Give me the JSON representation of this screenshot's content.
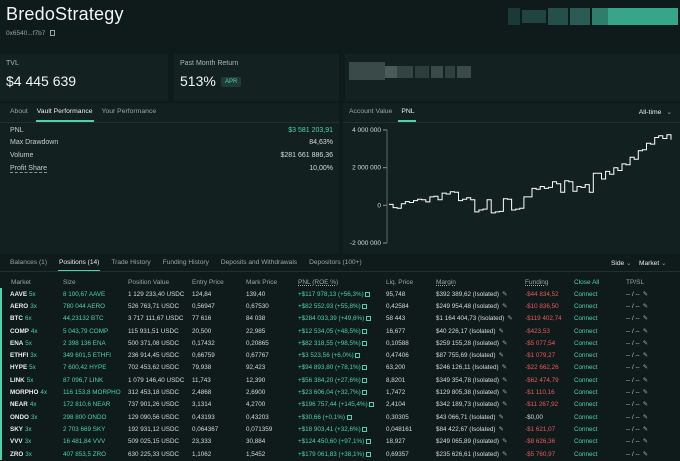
{
  "header": {
    "title": "BredoStrategy",
    "address": "0x6540...f7b7"
  },
  "tvl": {
    "label": "TVL",
    "value": "$4 445 639"
  },
  "pmr": {
    "label": "Past Month Return",
    "value": "513%",
    "badge": "APR"
  },
  "left_tabs": [
    "About",
    "Vault Performance",
    "Your Performance"
  ],
  "stats": [
    {
      "k": "PNL",
      "v": "$3 581 203,91",
      "color": "green"
    },
    {
      "k": "Max Drawdown",
      "v": "84,63%",
      "color": "plain"
    },
    {
      "k": "Volume",
      "v": "$281 661 886,36",
      "color": "plain"
    },
    {
      "k": "Profit Share",
      "v": "10,00%",
      "color": "plain"
    }
  ],
  "chart_tabs": [
    "Account Value",
    "PNL"
  ],
  "chart_range": "All-time",
  "chart_data": {
    "type": "line",
    "title": "",
    "ylabel": "",
    "yticks": [
      "4 000 000",
      "2 000 000",
      "0",
      "-2 000 000"
    ],
    "ylim": [
      -2000000,
      4000000
    ],
    "x": [
      0,
      1,
      2,
      3,
      4,
      5,
      6,
      7,
      8,
      9,
      10,
      11,
      12,
      13,
      14,
      15,
      16,
      17,
      18,
      19,
      20,
      21,
      22,
      23,
      24,
      25,
      26,
      27,
      28,
      29,
      30,
      31,
      32,
      33,
      34,
      35,
      36,
      37,
      38,
      39,
      40,
      41,
      42,
      43,
      44,
      45,
      46,
      47,
      48,
      49,
      50,
      51,
      52,
      53,
      54,
      55,
      56,
      57,
      58,
      59,
      60,
      61,
      62,
      63,
      64,
      65,
      66,
      67,
      68,
      69
    ],
    "values": [
      50000,
      -120000,
      -150000,
      80000,
      200000,
      150000,
      250000,
      320000,
      300000,
      180000,
      450000,
      480000,
      300000,
      650000,
      600000,
      720000,
      700000,
      250000,
      320000,
      400000,
      300000,
      -350000,
      -250000,
      -200000,
      300000,
      -400000,
      -350000,
      -320000,
      350000,
      320000,
      -250000,
      -200000,
      -150000,
      450000,
      450000,
      900000,
      850000,
      1000000,
      900000,
      950000,
      1250000,
      1150000,
      700000,
      1300000,
      1250000,
      750000,
      1000000,
      950000,
      1100000,
      700000,
      1700000,
      1700000,
      1400000,
      1800000,
      1650000,
      2000000,
      1850000,
      2200000,
      2150000,
      2550000,
      2450000,
      2900000,
      2950000,
      3300000,
      3250000,
      3600000,
      3700000,
      3550000,
      3750000,
      3480000
    ],
    "line_color": "#ffffff"
  },
  "bottom_tabs": [
    "Balances (1)",
    "Positions (14)",
    "Trade History",
    "Funding History",
    "Deposits and Withdrawals",
    "Depositors (100+)"
  ],
  "filters": [
    "Side",
    "Market"
  ],
  "columns": [
    "Market",
    "Size",
    "Position Value",
    "Entry Price",
    "Mark Price",
    "PNL (ROE %)",
    "Liq. Price",
    "Margin",
    "Funding",
    "Close All",
    "TP/SL"
  ],
  "positions": [
    {
      "coin": "AAVE",
      "lev": "5x",
      "size": "8 100,67 AAVE",
      "value": "1 129 233,40 USDC",
      "entry": "124,84",
      "mark": "139,40",
      "pnl": "+$117 978,13 (+56,3%)",
      "pnl_pos": true,
      "liq": "95,748",
      "margin": "$392 389,62 (Isolated)",
      "funding": "-$44 834,52",
      "fund_pos": false
    },
    {
      "coin": "AERO",
      "lev": "3x",
      "size": "780 044 AERO",
      "value": "526 763,71 USDC",
      "entry": "0,56947",
      "mark": "0,67530",
      "pnl": "+$82 552,93 (+55,8%)",
      "pnl_pos": true,
      "liq": "0,42584",
      "margin": "$249 954,48 (Isolated)",
      "funding": "-$10 836,50",
      "fund_pos": false
    },
    {
      "coin": "BTC",
      "lev": "6x",
      "size": "44,23132 BTC",
      "value": "3 717 111,67 USDC",
      "entry": "77 616",
      "mark": "84 038",
      "pnl": "+$284 033,39 (+49,6%)",
      "pnl_pos": true,
      "liq": "58 443",
      "margin": "$1 164 404,73 (Isolated)",
      "funding": "-$119 402,74",
      "fund_pos": false
    },
    {
      "coin": "COMP",
      "lev": "4x",
      "size": "5 043,79 COMP",
      "value": "115 931,51 USDC",
      "entry": "20,500",
      "mark": "22,985",
      "pnl": "+$12 534,05 (+48,5%)",
      "pnl_pos": true,
      "liq": "16,677",
      "margin": "$40 226,17 (Isolated)",
      "funding": "-$423,53",
      "fund_pos": false
    },
    {
      "coin": "ENA",
      "lev": "5x",
      "size": "2 398 136 ENA",
      "value": "500 371,08 USDC",
      "entry": "0,17432",
      "mark": "0,20865",
      "pnl": "+$82 318,55 (+98,5%)",
      "pnl_pos": true,
      "liq": "0,10588",
      "margin": "$259 155,28 (Isolated)",
      "funding": "-$5 077,54",
      "fund_pos": false
    },
    {
      "coin": "ETHFI",
      "lev": "3x",
      "size": "349 601,5 ETHFI",
      "value": "236 914,45 USDC",
      "entry": "0,66759",
      "mark": "0,67767",
      "pnl": "+$3 523,56 (+6,0%)",
      "pnl_pos": true,
      "liq": "0,47406",
      "margin": "$87 755,69 (Isolated)",
      "funding": "-$1 079,27",
      "fund_pos": false
    },
    {
      "coin": "HYPE",
      "lev": "5x",
      "size": "7 600,42 HYPE",
      "value": "702 453,62 USDC",
      "entry": "79,938",
      "mark": "92,423",
      "pnl": "+$94 893,80 (+78,1%)",
      "pnl_pos": true,
      "liq": "63,200",
      "margin": "$246 126,11 (Isolated)",
      "funding": "-$22 662,26",
      "fund_pos": false
    },
    {
      "coin": "LINK",
      "lev": "5x",
      "size": "87 096,7 LINK",
      "value": "1 079 146,40 USDC",
      "entry": "11,743",
      "mark": "12,390",
      "pnl": "+$56 384,20 (+27,6%)",
      "pnl_pos": true,
      "liq": "8,8201",
      "margin": "$349 354,78 (Isolated)",
      "funding": "-$62 474,79",
      "fund_pos": false
    },
    {
      "coin": "MORPHO",
      "lev": "4x",
      "size": "116 153,8 MORPHO",
      "value": "312 453,18 USDC",
      "entry": "2,4868",
      "mark": "2,6900",
      "pnl": "+$23 606,04 (+32,7%)",
      "pnl_pos": true,
      "liq": "1,7472",
      "margin": "$129 805,38 (Isolated)",
      "funding": "-$1 110,16",
      "fund_pos": false
    },
    {
      "coin": "NEAR",
      "lev": "4x",
      "size": "172 810,6 NEAR",
      "value": "737 901,26 USDC",
      "entry": "3,1314",
      "mark": "4,2700",
      "pnl": "+$196 757,44 (+145,4%)",
      "pnl_pos": true,
      "liq": "2,4104",
      "margin": "$342 189,73 (Isolated)",
      "funding": "-$11 267,92",
      "fund_pos": false
    },
    {
      "coin": "ONDO",
      "lev": "3x",
      "size": "298 800 ONDO",
      "value": "129 090,56 USDC",
      "entry": "0,43193",
      "mark": "0,43203",
      "pnl": "+$30,66 (+0,1%)",
      "pnl_pos": true,
      "liq": "0,30305",
      "margin": "$43 066,71 (Isolated)",
      "funding": "-$0,00",
      "fund_pos": null
    },
    {
      "coin": "SKY",
      "lev": "3x",
      "size": "2 703 669 SKY",
      "value": "192 931,12 USDC",
      "entry": "0,064367",
      "mark": "0,071359",
      "pnl": "+$18 903,41 (+32,6%)",
      "pnl_pos": true,
      "liq": "0,048161",
      "margin": "$84 422,67 (Isolated)",
      "funding": "-$1 621,07",
      "fund_pos": false
    },
    {
      "coin": "VVV",
      "lev": "3x",
      "size": "16 481,84 VVV",
      "value": "509 025,15 USDC",
      "entry": "23,333",
      "mark": "30,884",
      "pnl": "+$124 450,60 (+97,1%)",
      "pnl_pos": true,
      "liq": "18,927",
      "margin": "$249 065,89 (Isolated)",
      "funding": "-$8 626,36",
      "fund_pos": false
    },
    {
      "coin": "ZRO",
      "lev": "3x",
      "size": "407 853,5 ZRO",
      "value": "630 225,33 USDC",
      "entry": "1,1062",
      "mark": "1,5452",
      "pnl": "+$179 061,83 (+38,1%)",
      "pnl_pos": true,
      "liq": "0,69357",
      "margin": "$235 626,61 (Isolated)",
      "funding": "-$5 760,97",
      "fund_pos": false
    }
  ],
  "row_tail": {
    "close": "Connect",
    "tpsl": "-- / --"
  }
}
